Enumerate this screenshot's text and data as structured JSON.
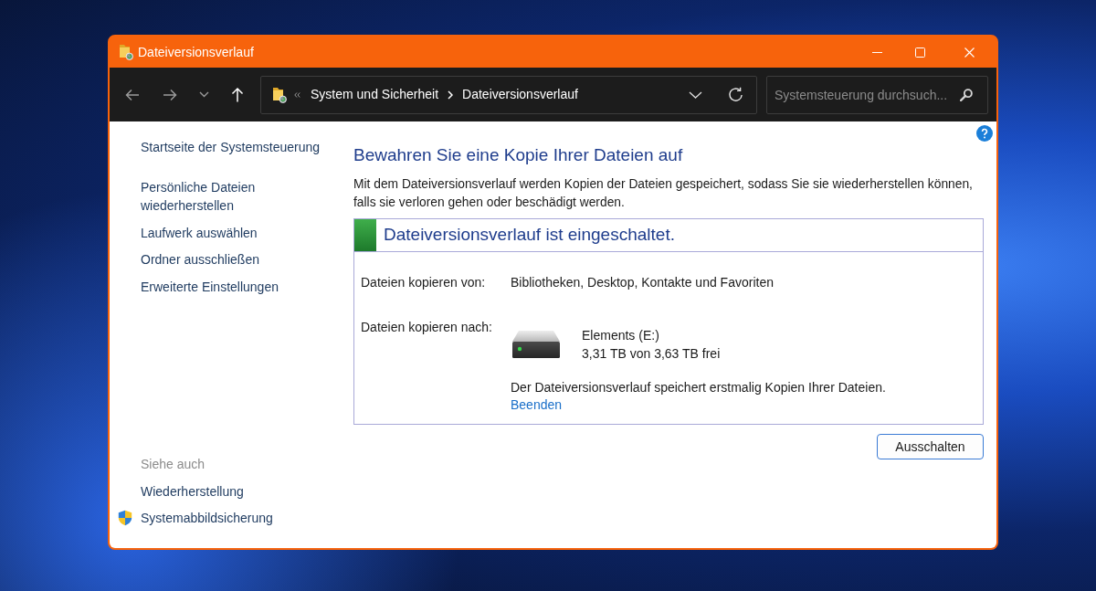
{
  "window": {
    "title": "Dateiversionsverlauf"
  },
  "toolbar": {
    "nav": [
      {
        "kind": "back",
        "disabled": true
      },
      {
        "kind": "forward",
        "disabled": true
      },
      {
        "kind": "recent",
        "disabled": true
      },
      {
        "kind": "up",
        "disabled": false
      }
    ],
    "address": {
      "segments": [
        "System und Sicherheit",
        "Dateiversionsverlauf"
      ]
    },
    "search": {
      "placeholder": "Systemsteuerung durchsuch..."
    }
  },
  "sidebar": {
    "home": "Startseite der Systemsteuerung",
    "items": [
      "Persönliche Dateien wiederherstellen",
      "Laufwerk auswählen",
      "Ordner ausschließen",
      "Erweiterte Einstellungen"
    ],
    "see_also": {
      "title": "Siehe auch",
      "items": [
        {
          "label": "Wiederherstellung",
          "kind": "link"
        },
        {
          "label": "Systemabbildsicherung",
          "kind": "shield"
        }
      ]
    }
  },
  "main": {
    "heading": "Bewahren Sie eine Kopie Ihrer Dateien auf",
    "description": "Mit dem Dateiversionsverlauf werden Kopien der Dateien gespeichert, sodass Sie sie wiederherstellen können, falls sie verloren gehen oder beschädigt werden.",
    "status": {
      "on": true,
      "title": "Dateiversionsverlauf ist eingeschaltet.",
      "source": {
        "label": "Dateien kopieren von:",
        "value": "Bibliotheken, Desktop, Kontakte und Favoriten"
      },
      "target": {
        "label": "Dateien kopieren nach:",
        "drive_name": "Elements (E:)",
        "drive_space": "3,31 TB von 3,63 TB frei"
      },
      "message": "Der Dateiversionsverlauf speichert erstmalig Kopien Ihrer Dateien.",
      "link": "Beenden"
    },
    "buttons": [
      "Ausschalten"
    ]
  }
}
